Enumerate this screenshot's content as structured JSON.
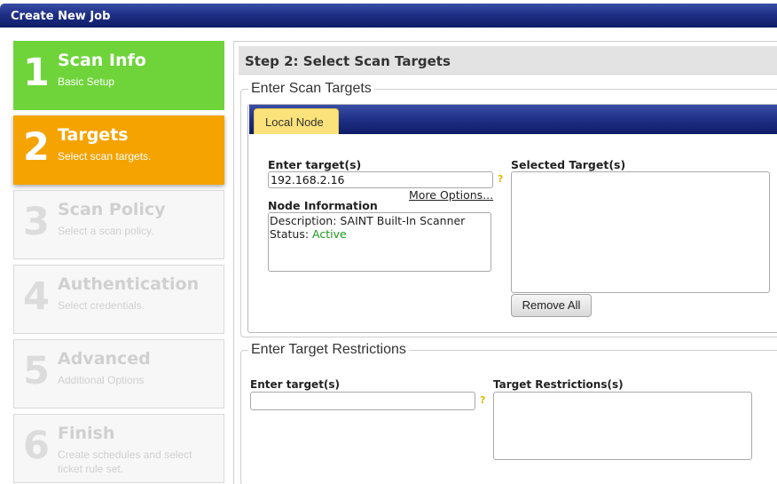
{
  "window": {
    "title": "Create New Job"
  },
  "steps": [
    {
      "num": "1",
      "title": "Scan Info",
      "subtitle": "Basic Setup"
    },
    {
      "num": "2",
      "title": "Targets",
      "subtitle": "Select scan targets."
    },
    {
      "num": "3",
      "title": "Scan Policy",
      "subtitle": "Select a scan policy."
    },
    {
      "num": "4",
      "title": "Authentication",
      "subtitle": "Select credentials."
    },
    {
      "num": "5",
      "title": "Advanced",
      "subtitle": "Additional Options"
    },
    {
      "num": "6",
      "title": "Finish",
      "subtitle": "Create schedules and select ticket rule set."
    }
  ],
  "main": {
    "step_header": "Step 2: Select Scan Targets",
    "scan_targets": {
      "legend": "Enter Scan Targets",
      "tab_label": "Local Node",
      "enter_label": "Enter target(s)",
      "target_value": "192.168.2.16",
      "help": "?",
      "more_options": "More Options...",
      "node_info_label": "Node Information",
      "description": "Description: SAINT Built-In Scanner",
      "status_label": "Status: ",
      "status_value": "Active",
      "selected_label": "Selected Target(s)",
      "remove_all": "Remove All"
    },
    "restrictions": {
      "legend": "Enter Target Restrictions",
      "enter_label": "Enter target(s)",
      "target_value": "",
      "help": "?",
      "restrictions_label": "Target Restrictions(s)"
    }
  },
  "colors": {
    "title_bar": "#1e2f86",
    "step_done": "#6ed43a",
    "step_active": "#f5a300",
    "tab": "#fbe27a",
    "status_active": "#1a9a1a"
  }
}
